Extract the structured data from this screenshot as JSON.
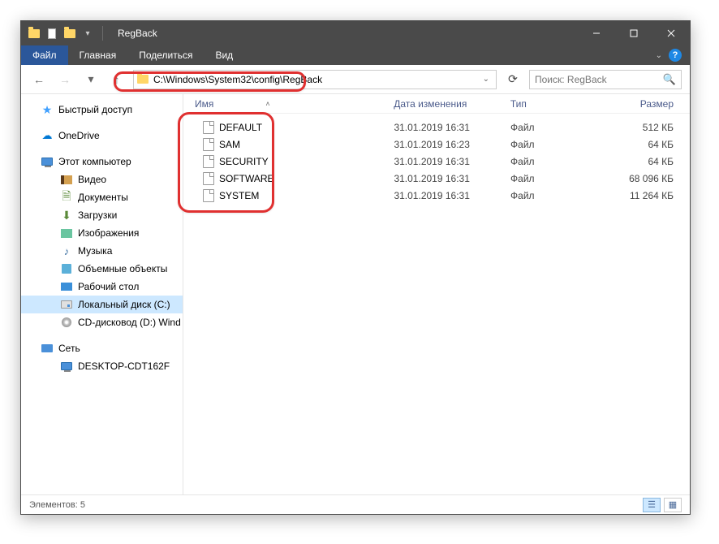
{
  "window": {
    "title": "RegBack"
  },
  "ribbon": {
    "file": "Файл",
    "tabs": [
      "Главная",
      "Поделиться",
      "Вид"
    ]
  },
  "address": {
    "path": "C:\\Windows\\System32\\config\\RegBack"
  },
  "search": {
    "placeholder": "Поиск: RegBack"
  },
  "navpane": {
    "quick_access": "Быстрый доступ",
    "onedrive": "OneDrive",
    "this_pc": "Этот компьютер",
    "items": [
      "Видео",
      "Документы",
      "Загрузки",
      "Изображения",
      "Музыка",
      "Объемные объекты",
      "Рабочий стол",
      "Локальный диск (C:)",
      "CD-дисковод (D:) Wind"
    ],
    "network": "Сеть",
    "network_items": [
      "DESKTOP-CDT162F"
    ]
  },
  "columns": {
    "name": "Имя",
    "date": "Дата изменения",
    "type": "Тип",
    "size": "Размер"
  },
  "files": [
    {
      "name": "DEFAULT",
      "date": "31.01.2019 16:31",
      "type": "Файл",
      "size": "512 КБ"
    },
    {
      "name": "SAM",
      "date": "31.01.2019 16:23",
      "type": "Файл",
      "size": "64 КБ"
    },
    {
      "name": "SECURITY",
      "date": "31.01.2019 16:31",
      "type": "Файл",
      "size": "64 КБ"
    },
    {
      "name": "SOFTWARE",
      "date": "31.01.2019 16:31",
      "type": "Файл",
      "size": "68 096 КБ"
    },
    {
      "name": "SYSTEM",
      "date": "31.01.2019 16:31",
      "type": "Файл",
      "size": "11 264 КБ"
    }
  ],
  "status": {
    "count": "Элементов: 5"
  }
}
